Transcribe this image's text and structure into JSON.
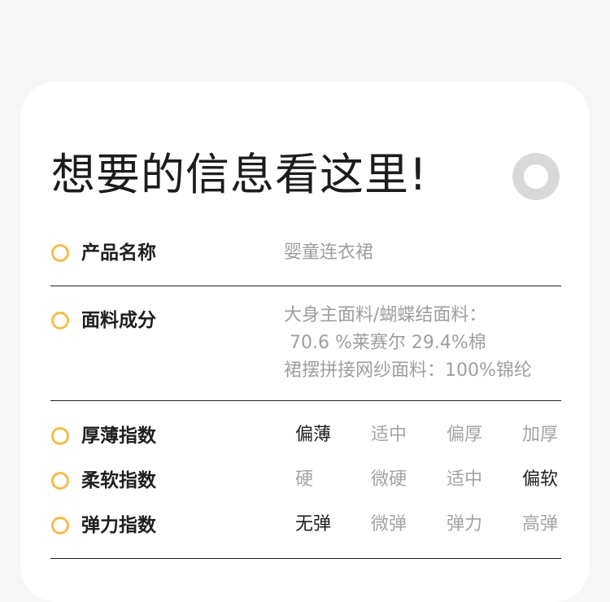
{
  "title": "想要的信息看这里!",
  "rows": {
    "name": {
      "label": "产品名称",
      "value": "婴童连衣裙"
    },
    "fabric": {
      "label": "面料成分",
      "lines": [
        "大身主面料/蝴蝶结面料：",
        " 70.6 %莱赛尔 29.4%棉",
        "裙摆拼接网纱面料：100%锦纶"
      ]
    }
  },
  "indices": [
    {
      "label": "厚薄指数",
      "options": [
        "偏薄",
        "适中",
        "偏厚",
        "加厚"
      ],
      "selected": "偏薄"
    },
    {
      "label": "柔软指数",
      "options": [
        "硬",
        "微硬",
        "适中",
        "偏软"
      ],
      "selected": "偏软"
    },
    {
      "label": "弹力指数",
      "options": [
        "无弹",
        "微弹",
        "弹力",
        "高弹"
      ],
      "selected": "无弹"
    }
  ],
  "colors": {
    "accent": "#f4bc4c",
    "ring": "#d9d9d9",
    "text": "#1f1f1f",
    "muted": "#9e9e9e"
  }
}
